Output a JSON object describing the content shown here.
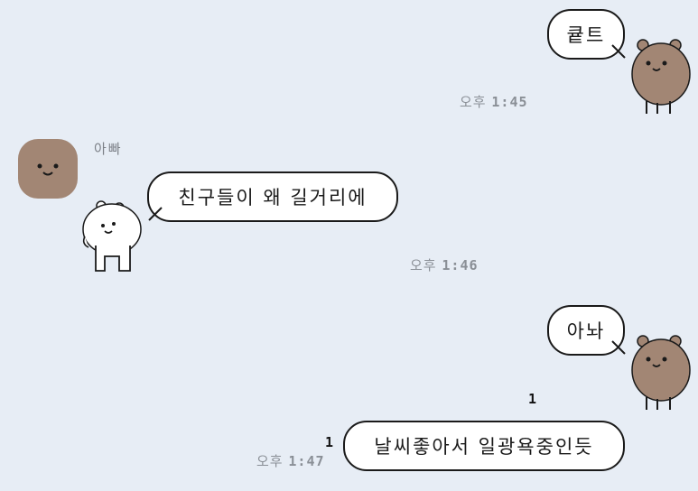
{
  "messages": [
    {
      "side": "right",
      "text": "큩트",
      "time_period": "오후",
      "time_clock": "1:45"
    },
    {
      "side": "left",
      "sender": "아빠",
      "text": "친구들이 왜 길거리에",
      "time_period": "오후",
      "time_clock": "1:46"
    },
    {
      "side": "right",
      "text": "아놔",
      "read_count": "1"
    },
    {
      "side": "right",
      "text": "날씨좋아서 일광욕중인듯",
      "read_count": "1",
      "time_period": "오후",
      "time_clock": "1:47"
    }
  ],
  "icons": {
    "my_avatar": "brown-bear-icon",
    "dad_avatar": "brown-face-icon",
    "sticker": "white-bear-icon"
  },
  "colors": {
    "background": "#e7edf5",
    "bubble": "#ffffff",
    "bear_brown": "#a28674"
  }
}
